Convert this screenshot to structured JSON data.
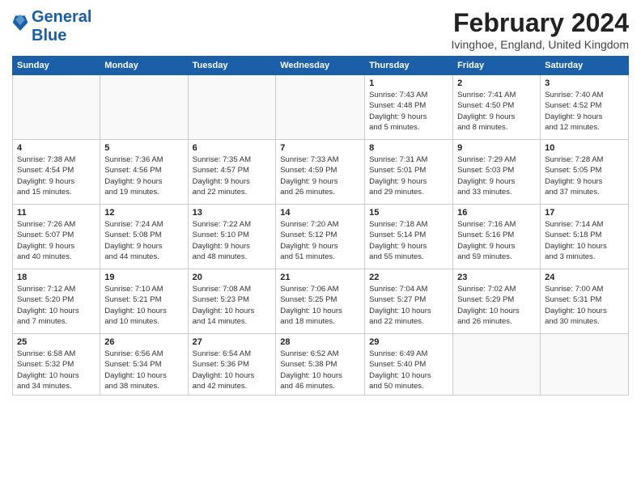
{
  "header": {
    "logo_line1": "General",
    "logo_line2": "Blue",
    "month_year": "February 2024",
    "location": "Ivinghoe, England, United Kingdom"
  },
  "weekdays": [
    "Sunday",
    "Monday",
    "Tuesday",
    "Wednesday",
    "Thursday",
    "Friday",
    "Saturday"
  ],
  "weeks": [
    [
      {
        "day": "",
        "info": ""
      },
      {
        "day": "",
        "info": ""
      },
      {
        "day": "",
        "info": ""
      },
      {
        "day": "",
        "info": ""
      },
      {
        "day": "1",
        "info": "Sunrise: 7:43 AM\nSunset: 4:48 PM\nDaylight: 9 hours\nand 5 minutes."
      },
      {
        "day": "2",
        "info": "Sunrise: 7:41 AM\nSunset: 4:50 PM\nDaylight: 9 hours\nand 8 minutes."
      },
      {
        "day": "3",
        "info": "Sunrise: 7:40 AM\nSunset: 4:52 PM\nDaylight: 9 hours\nand 12 minutes."
      }
    ],
    [
      {
        "day": "4",
        "info": "Sunrise: 7:38 AM\nSunset: 4:54 PM\nDaylight: 9 hours\nand 15 minutes."
      },
      {
        "day": "5",
        "info": "Sunrise: 7:36 AM\nSunset: 4:56 PM\nDaylight: 9 hours\nand 19 minutes."
      },
      {
        "day": "6",
        "info": "Sunrise: 7:35 AM\nSunset: 4:57 PM\nDaylight: 9 hours\nand 22 minutes."
      },
      {
        "day": "7",
        "info": "Sunrise: 7:33 AM\nSunset: 4:59 PM\nDaylight: 9 hours\nand 26 minutes."
      },
      {
        "day": "8",
        "info": "Sunrise: 7:31 AM\nSunset: 5:01 PM\nDaylight: 9 hours\nand 29 minutes."
      },
      {
        "day": "9",
        "info": "Sunrise: 7:29 AM\nSunset: 5:03 PM\nDaylight: 9 hours\nand 33 minutes."
      },
      {
        "day": "10",
        "info": "Sunrise: 7:28 AM\nSunset: 5:05 PM\nDaylight: 9 hours\nand 37 minutes."
      }
    ],
    [
      {
        "day": "11",
        "info": "Sunrise: 7:26 AM\nSunset: 5:07 PM\nDaylight: 9 hours\nand 40 minutes."
      },
      {
        "day": "12",
        "info": "Sunrise: 7:24 AM\nSunset: 5:08 PM\nDaylight: 9 hours\nand 44 minutes."
      },
      {
        "day": "13",
        "info": "Sunrise: 7:22 AM\nSunset: 5:10 PM\nDaylight: 9 hours\nand 48 minutes."
      },
      {
        "day": "14",
        "info": "Sunrise: 7:20 AM\nSunset: 5:12 PM\nDaylight: 9 hours\nand 51 minutes."
      },
      {
        "day": "15",
        "info": "Sunrise: 7:18 AM\nSunset: 5:14 PM\nDaylight: 9 hours\nand 55 minutes."
      },
      {
        "day": "16",
        "info": "Sunrise: 7:16 AM\nSunset: 5:16 PM\nDaylight: 9 hours\nand 59 minutes."
      },
      {
        "day": "17",
        "info": "Sunrise: 7:14 AM\nSunset: 5:18 PM\nDaylight: 10 hours\nand 3 minutes."
      }
    ],
    [
      {
        "day": "18",
        "info": "Sunrise: 7:12 AM\nSunset: 5:20 PM\nDaylight: 10 hours\nand 7 minutes."
      },
      {
        "day": "19",
        "info": "Sunrise: 7:10 AM\nSunset: 5:21 PM\nDaylight: 10 hours\nand 10 minutes."
      },
      {
        "day": "20",
        "info": "Sunrise: 7:08 AM\nSunset: 5:23 PM\nDaylight: 10 hours\nand 14 minutes."
      },
      {
        "day": "21",
        "info": "Sunrise: 7:06 AM\nSunset: 5:25 PM\nDaylight: 10 hours\nand 18 minutes."
      },
      {
        "day": "22",
        "info": "Sunrise: 7:04 AM\nSunset: 5:27 PM\nDaylight: 10 hours\nand 22 minutes."
      },
      {
        "day": "23",
        "info": "Sunrise: 7:02 AM\nSunset: 5:29 PM\nDaylight: 10 hours\nand 26 minutes."
      },
      {
        "day": "24",
        "info": "Sunrise: 7:00 AM\nSunset: 5:31 PM\nDaylight: 10 hours\nand 30 minutes."
      }
    ],
    [
      {
        "day": "25",
        "info": "Sunrise: 6:58 AM\nSunset: 5:32 PM\nDaylight: 10 hours\nand 34 minutes."
      },
      {
        "day": "26",
        "info": "Sunrise: 6:56 AM\nSunset: 5:34 PM\nDaylight: 10 hours\nand 38 minutes."
      },
      {
        "day": "27",
        "info": "Sunrise: 6:54 AM\nSunset: 5:36 PM\nDaylight: 10 hours\nand 42 minutes."
      },
      {
        "day": "28",
        "info": "Sunrise: 6:52 AM\nSunset: 5:38 PM\nDaylight: 10 hours\nand 46 minutes."
      },
      {
        "day": "29",
        "info": "Sunrise: 6:49 AM\nSunset: 5:40 PM\nDaylight: 10 hours\nand 50 minutes."
      },
      {
        "day": "",
        "info": ""
      },
      {
        "day": "",
        "info": ""
      }
    ]
  ]
}
